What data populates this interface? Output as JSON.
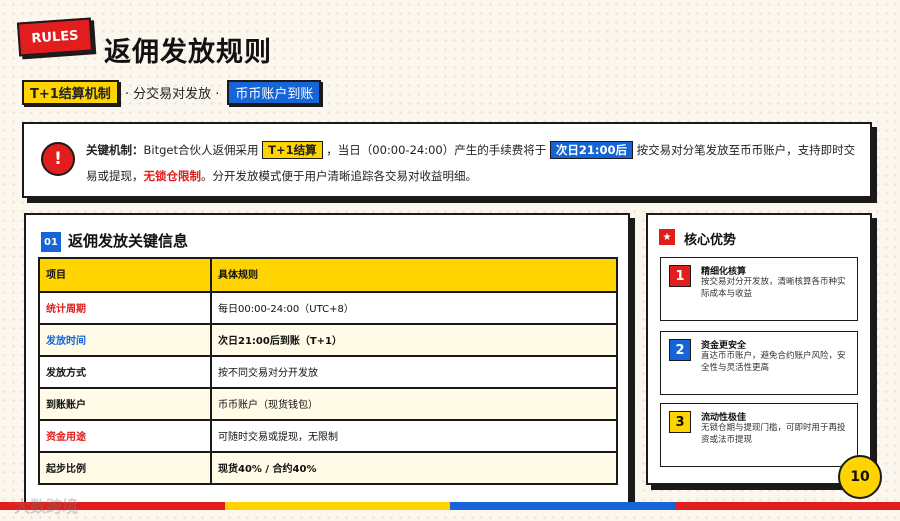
{
  "badge": "RULES",
  "title": "返佣发放规则",
  "subtitle": {
    "tag1": "T+1结算机制",
    "middle": "· 分交易对发放 ·",
    "tag2": "币币账户到账"
  },
  "notice": {
    "label": "关键机制：",
    "t1": "Bitget合伙人返佣采用",
    "h1": "T+1结算",
    "t2": "，当日（00:00-24:00）产生的手续费将于",
    "h2": "次日21:00后",
    "t3": "按交易对分笔发放至币币账户，支持即时交易或提现，",
    "h3": "无锁仓限制",
    "t4": "。分开发放模式便于用户清晰追踪各交易对收益明细。"
  },
  "section": {
    "num": "01",
    "title": "返佣发放关键信息",
    "headers": [
      "项目",
      "具体规则"
    ],
    "rows": [
      {
        "item": "统计周期",
        "rule": "每日00:00-24:00（UTC+8）"
      },
      {
        "item": "发放时间",
        "rule": "次日21:00后到账（T+1）"
      },
      {
        "item": "发放方式",
        "rule": "按不同交易对分开发放"
      },
      {
        "item": "到账账户",
        "rule": "币币账户（现货钱包）"
      },
      {
        "item": "资金用途",
        "rule": "可随时交易或提现，无限制"
      },
      {
        "item": "起步比例",
        "rule": "现货40% / 合约40%"
      }
    ]
  },
  "advantages": {
    "title": "核心优势",
    "items": [
      {
        "num": "1",
        "title": "精细化核算",
        "desc": "按交易对分开发放，清晰核算各币种实际成本与收益"
      },
      {
        "num": "2",
        "title": "资金更安全",
        "desc": "直达币币账户，避免合约账户风险，安全性与灵活性更高"
      },
      {
        "num": "3",
        "title": "流动性极佳",
        "desc": "无锁仓期与提现门槛，可即时用于再投资或法币提现"
      }
    ]
  },
  "page_number": "10",
  "watermark": "大数跨境",
  "colors": {
    "red": "#e11d1d",
    "blue": "#1565d8",
    "yellow": "#ffd400"
  }
}
